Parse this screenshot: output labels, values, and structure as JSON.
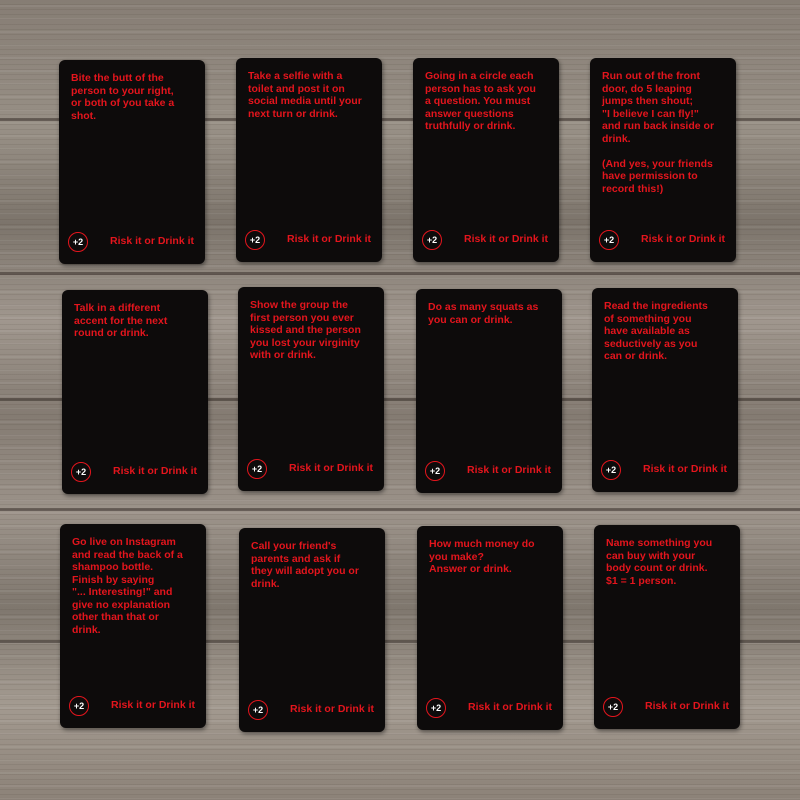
{
  "cards": [
    {
      "text": "Bite the butt of the\nperson to your right,\nor both of you take a\nshot.",
      "badge": "+2",
      "brand": "Risk it or Drink it"
    },
    {
      "text": "Take a selfie with a\ntoilet and post it on\nsocial media until your\nnext turn or drink.",
      "badge": "+2",
      "brand": "Risk it or Drink it"
    },
    {
      "text": "Going in a circle each\nperson has to ask you\na question. You must\nanswer questions\ntruthfully or drink.",
      "badge": "+2",
      "brand": "Risk it or Drink it"
    },
    {
      "text": "Run out of the front\ndoor, do 5 leaping\njumps then shout;\n\"I believe I can fly!\"\nand run back inside or\ndrink.\n\n(And yes, your friends\nhave permission to\nrecord this!)",
      "badge": "+2",
      "brand": "Risk it or Drink it"
    },
    {
      "text": "Talk in a different\naccent for the next\nround or drink.",
      "badge": "+2",
      "brand": "Risk it or Drink it"
    },
    {
      "text": "Show the group the\nfirst person you ever\nkissed and the person\nyou lost your virginity\nwith or drink.",
      "badge": "+2",
      "brand": "Risk it or Drink it"
    },
    {
      "text": "Do as many squats as\nyou can or drink.",
      "badge": "+2",
      "brand": "Risk it or Drink it"
    },
    {
      "text": "Read the ingredients\nof something you\nhave available as\nseductively as you\ncan or drink.",
      "badge": "+2",
      "brand": "Risk it or Drink it"
    },
    {
      "text": "Go live on Instagram\nand read the back of a\nshampoo bottle.\nFinish by saying\n\"... Interesting!\" and\ngive no explanation\nother than that or\ndrink.",
      "badge": "+2",
      "brand": "Risk it or Drink it"
    },
    {
      "text": "Call your friend's\nparents and ask if\nthey will adopt you or\ndrink.",
      "badge": "+2",
      "brand": "Risk it or Drink it"
    },
    {
      "text": "How much money do\nyou make?\nAnswer or drink.",
      "badge": "+2",
      "brand": "Risk it or Drink it"
    },
    {
      "text": "Name something you\ncan buy with your\nbody count or drink.\n$1 = 1 person.",
      "badge": "+2",
      "brand": "Risk it or Drink it"
    }
  ]
}
